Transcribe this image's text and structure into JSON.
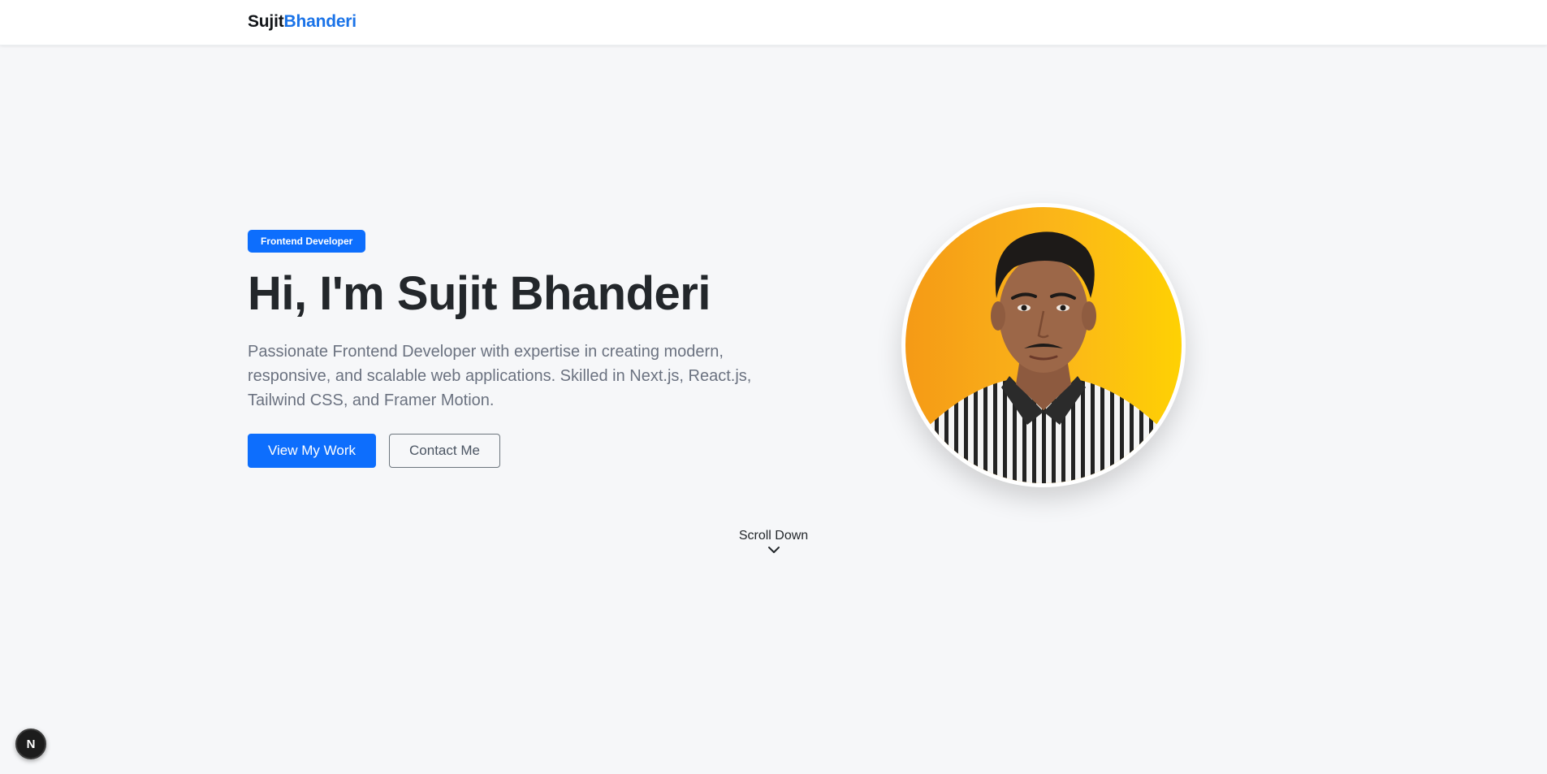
{
  "navbar": {
    "brand_first": "Sujit",
    "brand_last": "Bhanderi"
  },
  "hero": {
    "badge": "Frontend Developer",
    "title": "Hi, I'm Sujit Bhanderi",
    "description": "Passionate Frontend Developer with expertise in creating modern, responsive, and scalable web applications. Skilled in Next.js, React.js, Tailwind CSS, and Framer Motion.",
    "primary_button": "View My Work",
    "secondary_button": "Contact Me"
  },
  "scroll": {
    "label": "Scroll Down",
    "icon": "chevron-down-icon"
  },
  "dev_indicator": {
    "letter": "N"
  },
  "colors": {
    "accent": "#0d6efd",
    "brand_accent": "#1a73e8",
    "background": "#f6f7f9",
    "avatar_gradient_start": "#f59a16",
    "avatar_gradient_end": "#fed103"
  }
}
